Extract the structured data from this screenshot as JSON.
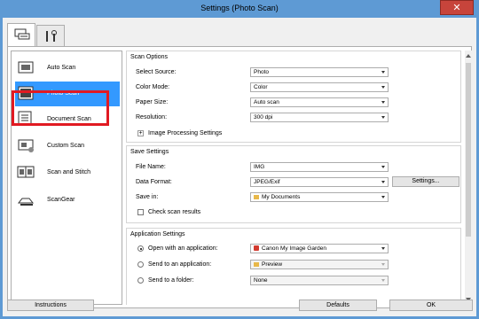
{
  "window": {
    "title": "Settings (Photo Scan)",
    "close_glyph": "✕"
  },
  "tabs": [
    {
      "icon": "scan-settings-icon",
      "active": true
    },
    {
      "icon": "general-settings-tools-icon",
      "active": false
    }
  ],
  "sidebar": {
    "items": [
      {
        "label": "Auto Scan",
        "icon": "auto-scan-icon"
      },
      {
        "label": "Photo Scan",
        "icon": "photo-scan-icon",
        "selected": true
      },
      {
        "label": "Document Scan",
        "icon": "document-scan-icon"
      },
      {
        "label": "Custom Scan",
        "icon": "custom-scan-icon"
      },
      {
        "label": "Scan and Stitch",
        "icon": "scan-and-stitch-icon"
      },
      {
        "label": "ScanGear",
        "icon": "scangear-icon"
      }
    ]
  },
  "scan_options": {
    "title": "Scan Options",
    "rows": [
      {
        "label": "Select Source:",
        "value": "Photo"
      },
      {
        "label": "Color Mode:",
        "value": "Color"
      },
      {
        "label": "Paper Size:",
        "value": "Auto scan"
      },
      {
        "label": "Resolution:",
        "value": "300 dpi"
      }
    ],
    "expand_symbol": "+",
    "image_processing_label": "Image Processing Settings"
  },
  "save_settings": {
    "title": "Save Settings",
    "file_name_label": "File Name:",
    "file_name_value": "IMG",
    "data_format_label": "Data Format:",
    "data_format_value": "JPEG/Exif",
    "settings_button": "Settings...",
    "save_in_label": "Save in:",
    "save_in_value": "My Documents",
    "check_results_label": "Check scan results"
  },
  "application_settings": {
    "title": "Application Settings",
    "open_with_label": "Open with an application:",
    "open_with_value": "Canon My Image Garden",
    "send_app_label": "Send to an application:",
    "send_app_value": "Preview",
    "send_folder_label": "Send to a folder:",
    "send_folder_value": "None"
  },
  "footer": {
    "instructions": "Instructions",
    "defaults": "Defaults",
    "ok": "OK"
  },
  "colors": {
    "title_bar": "#5e9ad4",
    "selection": "#3399ff",
    "highlight_box": "#e11a22",
    "close_button": "#c7443b"
  }
}
